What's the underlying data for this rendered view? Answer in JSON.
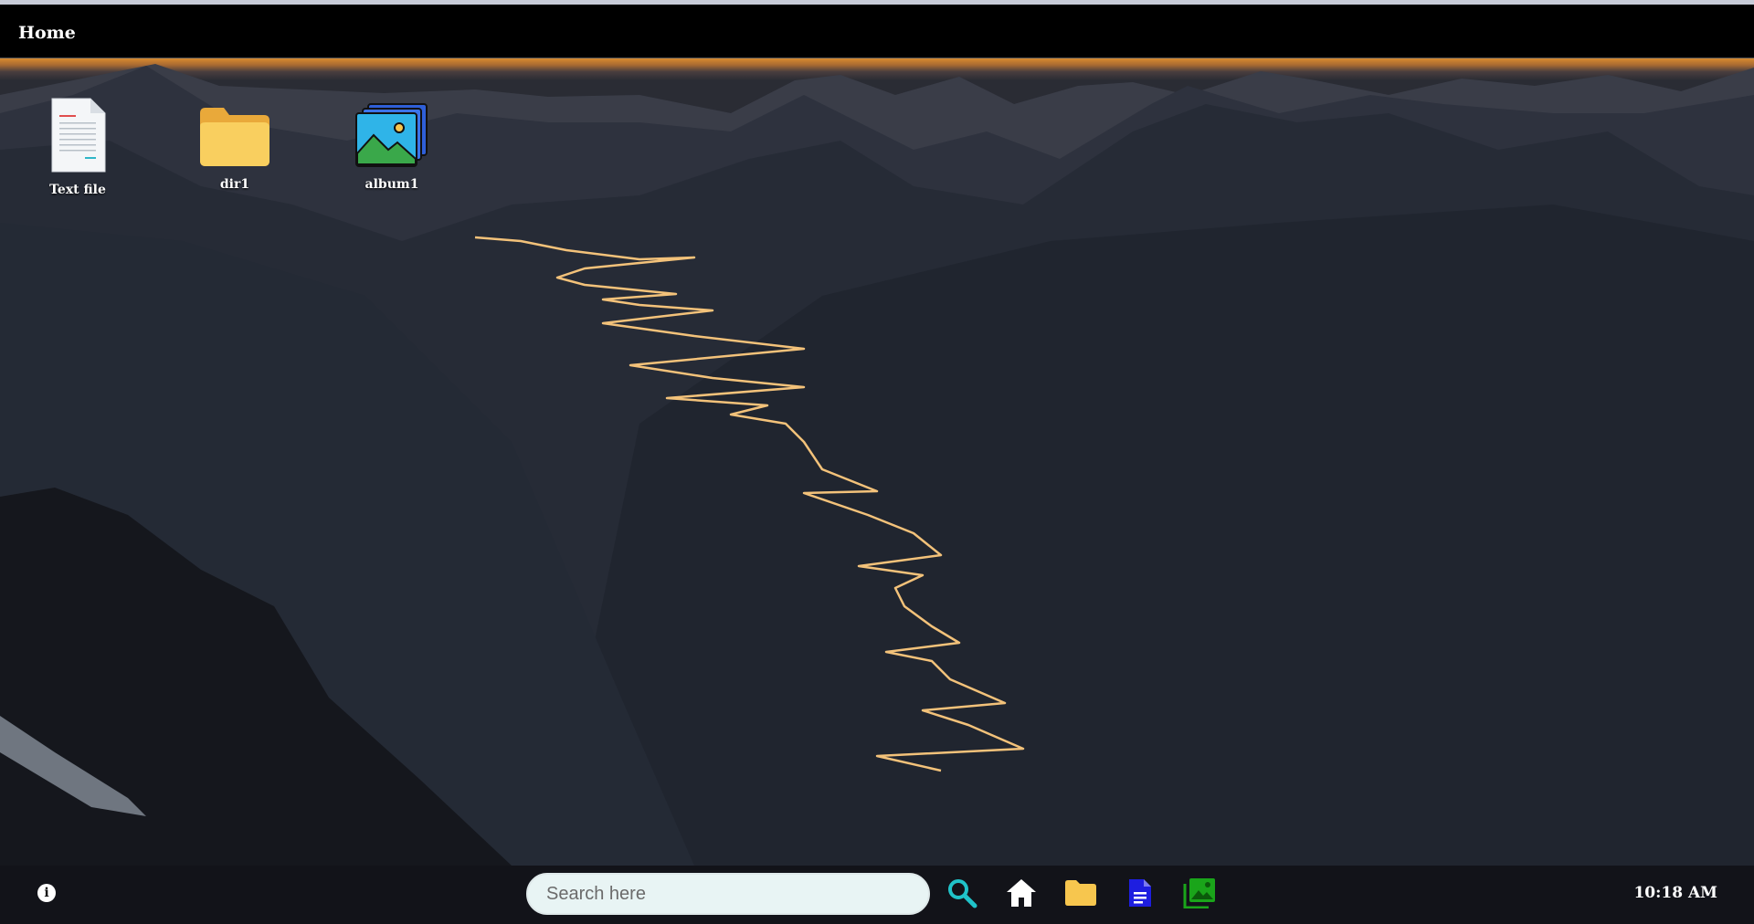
{
  "window": {
    "title": "Home"
  },
  "desktop": {
    "icons": [
      {
        "label": "Text file",
        "icon": "text-file-icon"
      },
      {
        "label": "dir1",
        "icon": "folder-icon"
      },
      {
        "label": "album1",
        "icon": "album-icon"
      }
    ]
  },
  "taskbar": {
    "info_icon": "info-icon",
    "search_placeholder": "Search here",
    "search_value": "",
    "apps": [
      "search-icon",
      "home-icon",
      "folder-icon",
      "document-icon",
      "gallery-icon"
    ],
    "clock": "10:18 AM"
  },
  "colors": {
    "search_icon": "#20c3c9",
    "folder": "#f7c64e",
    "document": "#1e1ee0",
    "gallery": "#1aa51a"
  }
}
